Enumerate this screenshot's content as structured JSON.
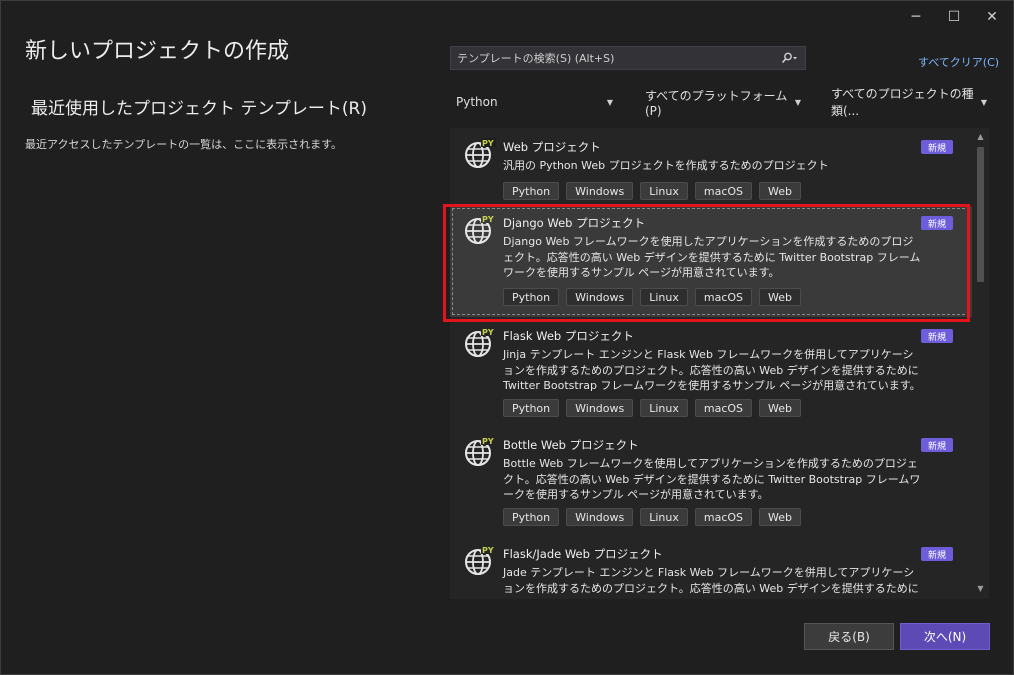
{
  "window": {
    "title": "新しいプロジェクトの作成",
    "controls": {
      "minimize": "─",
      "maximize": "☐",
      "close": "✕"
    }
  },
  "recent": {
    "title": "最近使用したプロジェクト テンプレート(R)",
    "description": "最近アクセスしたテンプレートの一覧は、ここに表示されます。"
  },
  "search": {
    "placeholder": "テンプレートの検索(S) (Alt+S)",
    "icon": "search-icon"
  },
  "clear_all": "すべてクリア(C)",
  "filters": {
    "language": "Python",
    "platform": "すべてのプラットフォーム(P)",
    "project_type": "すべてのプロジェクトの種類(..."
  },
  "templates": [
    {
      "name": "Web プロジェクト",
      "description": "汎用の Python Web プロジェクトを作成するためのプロジェクト",
      "badge": "新規",
      "tags": [
        "Python",
        "Windows",
        "Linux",
        "macOS",
        "Web"
      ]
    },
    {
      "name": "Django Web プロジェクト",
      "description": "Django Web フレームワークを使用したアプリケーションを作成するためのプロジェクト。応答性の高い Web デザインを提供するために Twitter Bootstrap フレームワークを使用するサンプル ページが用意されています。",
      "badge": "新規",
      "tags": [
        "Python",
        "Windows",
        "Linux",
        "macOS",
        "Web"
      ],
      "selected": true
    },
    {
      "name": "Flask Web プロジェクト",
      "description": "Jinja テンプレート エンジンと Flask Web フレームワークを併用してアプリケーションを作成するためのプロジェクト。応答性の高い Web デザインを提供するために Twitter Bootstrap フレームワークを使用するサンプル ページが用意されています。",
      "badge": "新規",
      "tags": [
        "Python",
        "Windows",
        "Linux",
        "macOS",
        "Web"
      ]
    },
    {
      "name": "Bottle Web プロジェクト",
      "description": "Bottle Web フレームワークを使用してアプリケーションを作成するためのプロジェクト。応答性の高い Web デザインを提供するために Twitter Bootstrap フレームワークを使用するサンプル ページが用意されています。",
      "badge": "新規",
      "tags": [
        "Python",
        "Windows",
        "Linux",
        "macOS",
        "Web"
      ]
    },
    {
      "name": "Flask/Jade Web プロジェクト",
      "description": "Jade テンプレート エンジンと Flask Web フレームワークを併用してアプリケーションを作成するためのプロジェクト。応答性の高い Web デザインを提供するために Twitter Bootstrap フ",
      "badge": "新規",
      "tags": []
    }
  ],
  "buttons": {
    "back": "戻る(B)",
    "next": "次へ(N)"
  },
  "colors": {
    "background": "#1f1f1f",
    "accent": "#6e5ddb",
    "link": "#7eb6ff",
    "highlight_box": "#e3141b"
  }
}
